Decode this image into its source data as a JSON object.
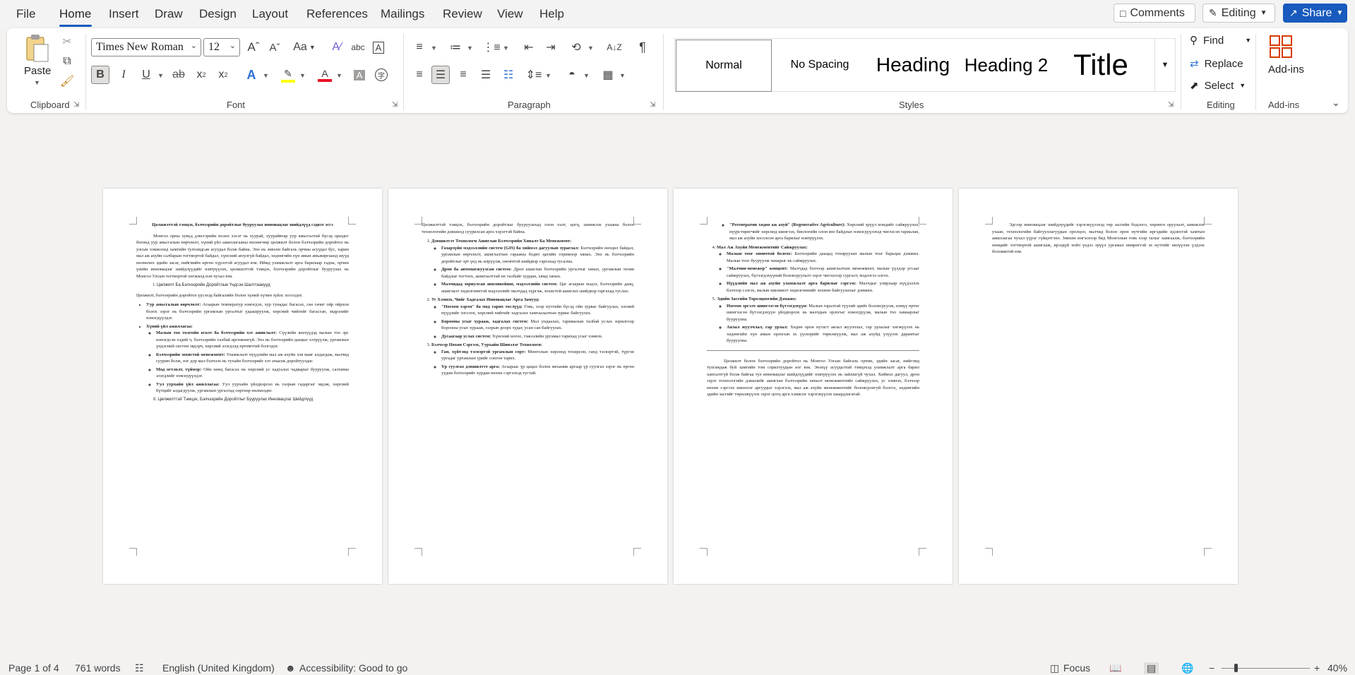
{
  "menu": {
    "items": [
      "File",
      "Home",
      "Insert",
      "Draw",
      "Design",
      "Layout",
      "References",
      "Mailings",
      "Review",
      "View",
      "Help"
    ],
    "active": "Home",
    "comments_label": "Comments",
    "editing_label": "Editing",
    "share_label": "Share"
  },
  "ribbon": {
    "clipboard": {
      "label": "Clipboard",
      "paste": "Paste"
    },
    "font": {
      "label": "Font",
      "name": "Times New Roman",
      "size": "12"
    },
    "paragraph": {
      "label": "Paragraph"
    },
    "styles": {
      "label": "Styles",
      "items": [
        "Normal",
        "No Spacing",
        "Heading",
        "Heading 2",
        "Title"
      ]
    },
    "editing": {
      "label": "Editing",
      "find": "Find",
      "replace": "Replace",
      "select": "Select"
    },
    "addins": {
      "label": "Add-ins",
      "button": "Add-ins"
    },
    "accent_color": "#185abd",
    "highlight_color": "#ffff00",
    "font_color": "#e81123"
  },
  "pages": [
    {
      "title": "Цөлжилттэй тэмцэх, бэлчээрийн доройтлыг бууруулах инновацлаг шийдлүүд сэдвэт эссэ",
      "intro": "Монгол орны хувьд дэвсгэрийн ихэнх хэсэг нь хуурай, хуурайвтар уур амьсгалтай бүсэд оршдог бөгөөд уур амьсгалын өөрчлөлт, хүний үйл ажиллагааны нөлөөгөөр цөлжилт болон бэлчээрийн доройтол нь улсын хэмжээнд хамгийн тулгамдсан асуудал болж байна. Энэ нь зөвхөн байгаль орчны асуудал бус, харин мал аж ахуйн салбарын тогтвортой байдал, хүнсний аюулгүй байдал, хөдөөгийн хүн амын амьжиргаанд шууд нөлөөлөх эдийн засаг, нийгмийн өргөн хүрээтэй асуудал юм. Иймд уламжлалт арга барилаар гадна, орчин үеийн инновацлаг шийдлүүдийг нэвтрүүлэх, цөлжилттэй тэмцэх, бэлчээрийн доройтлыг бууруулах нь Монгол Улсын тогтвортой хөгжилд нэн чухал юм.",
      "section1": "I. Цөлжилт Ба Бэлчээрийн Доройтлын Үндсэн Шалтгаанууд",
      "section1_text": "Цөлжилт, бэлчээрийн доройтол үүсэхэд байгалийн болон хүний хүчин зүйлс хосолдог.",
      "b1_title": "Уур амьсгалын өөрчлөлт:",
      "b1_text": "Агаарын температур нэмэгдэх, хур тунадас багасах, ган гачиг ойр ойрхон болох зэрэг нь бэлчээрийн ургамлын ургалтыг удаашруулж, хөрсний чийгийг багасган, эвдрэлийг нэмэгдүүлдэг.",
      "b2_title": "Хүний үйл ажиллагаа:",
      "s1_title": "Малын тоо толгойн өсөлт ба бэлчээрийн хэт ашиглалт:",
      "s1_text": "Сүүлийн жилүүдэд малын тоо эрс нэмэгдсэн хэдий ч, бэлчээрийн талбай өргөжөөгүй. Энэ нь бэлчээрийн даацыг хэтрүүлж, ургамлын үндэсний систем эвдэрч, хөрсний элэгдэлд өртөмтгий болгодог.",
      "s2_title": "Бэлчээрийн зохистой менежмент:",
      "s2_text": "Уламжлалт нүүдлийн мал аж ахуйн хэв маяг алдагдаж, малчид суурин болж, нэг дор мал бэлчээх нь тухайн бэлчээрийг хэт ачаалж доройтуулдаг.",
      "s3_title": "Мод огтлолт, түймэр:",
      "s3_text": "Ойн нөөц багасах нь хөрсний ус хадгалах чадварыг бууруулж, салхины элэгдлийг нэмэгдүүлдэг.",
      "s4_title": "Уул уурхайн үйл ажиллагаа:",
      "s4_text": "Уул уурхайн үйлдвэрлэл нь газрын гадаргыг эвдэж, хөрсний бүтцийг алдагдуулж, ургамлын ургалтад сөргөөр нөлөөлдөг.",
      "section2": "II. Цөлжилттэй Тэмцэх, Бэлчээрийн Доройтлыг Бууруулах Инновацлаг Шийдлүүд"
    },
    {
      "intro": "Цөлжилттэй тэмцэх, бэлчээрийн доройтлыг бууруулахад олон талт, цогц, шинжлэх ухааны болон технологийн дэвшилд суурилсан арга хэрэгтэй байна.",
      "l1": "Дэвшилтэт Технологи Ашиглан Бэлчээрийн Хяналт Ба Менежмент:",
      "l1a_t": "Газарзүйн мэдээллийн систем (GIS) ба хиймэл дагуулын зураглал:",
      "l1a": "Бэлчээрийн нөхцөл байдал, ургамлын өөрчлөлт, ашиглалтын гарааны бодит цагийн горимоор хянах. Энэ нь бэлчээрийн доройтлыг эрт үед нь илрүүлж, оновчтой шийдвэр гаргахад тусална.",
      "l1b_t": "Дрон ба автоматжуулсан систем:",
      "l1b": "Дрон ашиглан бэлчээрийн ургалтыг хянах, ургамлын төлөв байдлыг тогтоох, ашиглалттай их талбайг хурдан, хямд хянах.",
      "l1c_t": "Малчидад зориулсан аппликейшн, мэдээллийн систем:",
      "l1c": "Цаг агаарын мэдээ, бэлчээрийн даац, ашиглалт хөдөлгөөнтэй мэдээллийг малчдад хүргэж, зохистой ашиглах шийдвэр гаргахад туслах.",
      "l2": "Ус Хэмнэх, Чийг Хадгалах Инновацлаг Арга Замууд:",
      "l2a_t": "\"Ногоон хэрэм\" ба мод тарих төслүүд:",
      "l2a": "Говь, хээр нутгийн бүсэд ойн зурвас байгуулах, элсний нүүдлийг зогсоох, хөрсний чийгийг хадгалах хамгаалалтын зурвас байгуулах.",
      "l2b_t": "Борооны усыг хурааж, хадгалах систем:",
      "l2b": "Мал ундаалах, тарималын талбай услах зорилгоор борооны усыг хурааж, газрын доорх худаг, усан сан байгуулах.",
      "l2c_t": "Дусаагаар услах систем:",
      "l2c": "Хүнсний ногоо, тэжээлийн ургамал тарихад усыг хэмнэх.",
      "l3": "Бэлчээр Нөхөн Сэргээх, Уурхайн Шинэлэг Технологи:",
      "l3a_t": "Ган, хүйтэнд тэсвэртэй ургамлын сорт:",
      "l3a": "Монголын хөрсөнд тохирсон, ганд тэсвэртэй, түргэн ургадаг ургамлын үрийг сонгон тарих.",
      "l3b_t": "Үр суулгах дэвшилтэт арга:",
      "l3b": "Агаараас үр цацах болон механик аргаар үр суулгах зэрэг нь өргөн уудам бэлчээрийг хурдан нөхөн сэргээхэд тустай."
    },
    {
      "p1_t": "\"Регенератив хөдөө аж ахуй\" (Regenerative Agriculture):",
      "p1": "Хөрсний эрүүл мэндийг сайжруулах, нүүрстөрөгчийг хөрсөнд шингээх, биологийн олон янз байдлыг нэмэгдүүлэхэд чиглэсэн тариалан, мал аж ахуйн хосолсон арга барилыг нэвтрүүлэх.",
      "l4": "Мал Аж Ахуйн Менежментийг Сайжруулах:",
      "l4a_t": "Малын тоог оновчтой болгох:",
      "l4a": "Бэлчээрийн даацад тохируулан малын тоог барьцаа дэмжих. Малын тоог бууруулж чанарыг нь сайжруулах.",
      "l4b_t": "\"Малчин-менежер\" концепт:",
      "l4b": "Малчдад бэлчээр ашиглалтын менежмент, малын үүлдэр угсааг сайжруулах, бүтээгдэхүүний боловсруулалт зэрэг чиглэлээр сургалт, мэдлэгээ олгох.",
      "l4c_t": "Нүүдлийн мал аж ахуйн уламжлалт арга барилыг сэргээх:",
      "l4c": "Малчдыг улирлаар нүүдэллэх бэлчээр сэлгэх, малын шилжилт хөдөлгөөнийг зохион байгуулахыг дэмжих.",
      "l5": "Эдийн Засгийн Торолцоогийн Дэмжих:",
      "l5a_t": "Ногоон эргэлт шингээсэн бүтээгдэхүүн:",
      "l5a": "Малын гаралтай түүхий эдийг боловсруулж, нэмүү өртөг шингээсэн бүтээгдэхүүн үйлдвэрлэх нь малчдын орлогыг нэмэгдүүлж, малын тоо хамаарлыг бууруулна.",
      "l5b_t": "Аялал жуулчлал, гар урлал:",
      "l5b": "Хөдөө орон нутагт аялал жуулчлал, гар урлалыг хөгжүүлэх нь хөдөөгийн хүн амын орлогын эх үүсвэрийг төрөлжүүлж, мал аж ахуйд үзүүлэх дарамтыг бууруулна.",
      "conclusion": "Цөлжилт болон бэлчээрийн доройтол нь Монгол Улсын байгаль орчин, эдийн засаг, нийгэмд тулгамдаж буй хамгийн том сорилтуудын нэг юм. Энэхүү асуудалтай тэмцэхэд уламжлалт арга барил хангалтгүй болж байгаа тул инновацлаг шийдлүүдийг нэвтрүүлэх нь зайлшгүй чухал. Хиймэл дагуул, дрон зэрэг технологийн дэвшлийг ашиглан бэлчээрийн хяналт менежментийг сайжруулах, ус хэмнэх, бэлчээр нөхөн сэргээх шинэлэг аргуудыг хэрэглэх, мал аж ахуйн менежментийг боловсронгуй болгох, хөдөөгийн эдийн засгийг төрөлжүүлэх зэрэг цогц арга хэмжээг хэрэгжүүлэх шаардлагатай."
    },
    {
      "text": "Эдгээр инновацлаг шийдлүүдийг хэрэгжүүлэхэд төр засгийн бодлого, хөрөнгө оруулалт, шинжлэх ухаан, технологийн байгууллагуудын оролцоо, малчид болон орон нутгийн иргэдийн идэвхтэй хамтын ажиллагаа чухал үүрэг гүйцэтгэнэ. Зөвхөн ингэснээр бид Монголын говь хээр талыг хамгаалж, бэлчээрийн нөөцийг тогтвортой ашиглаж, ирээдүй хойч үедээ эрүүл ургамал нөмрөгтэй эх нутгийг өвлүүлэн үлдээх боломжтой юм."
    }
  ],
  "status": {
    "page": "Page 1 of 4",
    "words": "761 words",
    "language": "English (United Kingdom)",
    "accessibility": "Accessibility: Good to go",
    "focus": "Focus",
    "zoom": "40%"
  }
}
